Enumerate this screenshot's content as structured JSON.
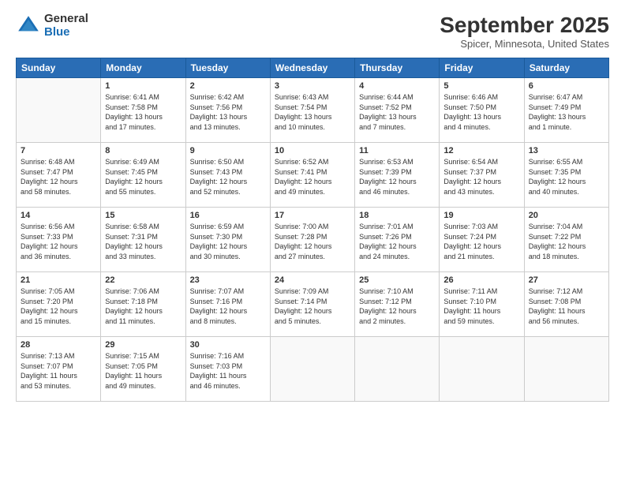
{
  "logo": {
    "general": "General",
    "blue": "Blue"
  },
  "title": {
    "main": "September 2025",
    "sub": "Spicer, Minnesota, United States"
  },
  "weekdays": [
    "Sunday",
    "Monday",
    "Tuesday",
    "Wednesday",
    "Thursday",
    "Friday",
    "Saturday"
  ],
  "weeks": [
    [
      {
        "day": "",
        "info": ""
      },
      {
        "day": "1",
        "info": "Sunrise: 6:41 AM\nSunset: 7:58 PM\nDaylight: 13 hours\nand 17 minutes."
      },
      {
        "day": "2",
        "info": "Sunrise: 6:42 AM\nSunset: 7:56 PM\nDaylight: 13 hours\nand 13 minutes."
      },
      {
        "day": "3",
        "info": "Sunrise: 6:43 AM\nSunset: 7:54 PM\nDaylight: 13 hours\nand 10 minutes."
      },
      {
        "day": "4",
        "info": "Sunrise: 6:44 AM\nSunset: 7:52 PM\nDaylight: 13 hours\nand 7 minutes."
      },
      {
        "day": "5",
        "info": "Sunrise: 6:46 AM\nSunset: 7:50 PM\nDaylight: 13 hours\nand 4 minutes."
      },
      {
        "day": "6",
        "info": "Sunrise: 6:47 AM\nSunset: 7:49 PM\nDaylight: 13 hours\nand 1 minute."
      }
    ],
    [
      {
        "day": "7",
        "info": "Sunrise: 6:48 AM\nSunset: 7:47 PM\nDaylight: 12 hours\nand 58 minutes."
      },
      {
        "day": "8",
        "info": "Sunrise: 6:49 AM\nSunset: 7:45 PM\nDaylight: 12 hours\nand 55 minutes."
      },
      {
        "day": "9",
        "info": "Sunrise: 6:50 AM\nSunset: 7:43 PM\nDaylight: 12 hours\nand 52 minutes."
      },
      {
        "day": "10",
        "info": "Sunrise: 6:52 AM\nSunset: 7:41 PM\nDaylight: 12 hours\nand 49 minutes."
      },
      {
        "day": "11",
        "info": "Sunrise: 6:53 AM\nSunset: 7:39 PM\nDaylight: 12 hours\nand 46 minutes."
      },
      {
        "day": "12",
        "info": "Sunrise: 6:54 AM\nSunset: 7:37 PM\nDaylight: 12 hours\nand 43 minutes."
      },
      {
        "day": "13",
        "info": "Sunrise: 6:55 AM\nSunset: 7:35 PM\nDaylight: 12 hours\nand 40 minutes."
      }
    ],
    [
      {
        "day": "14",
        "info": "Sunrise: 6:56 AM\nSunset: 7:33 PM\nDaylight: 12 hours\nand 36 minutes."
      },
      {
        "day": "15",
        "info": "Sunrise: 6:58 AM\nSunset: 7:31 PM\nDaylight: 12 hours\nand 33 minutes."
      },
      {
        "day": "16",
        "info": "Sunrise: 6:59 AM\nSunset: 7:30 PM\nDaylight: 12 hours\nand 30 minutes."
      },
      {
        "day": "17",
        "info": "Sunrise: 7:00 AM\nSunset: 7:28 PM\nDaylight: 12 hours\nand 27 minutes."
      },
      {
        "day": "18",
        "info": "Sunrise: 7:01 AM\nSunset: 7:26 PM\nDaylight: 12 hours\nand 24 minutes."
      },
      {
        "day": "19",
        "info": "Sunrise: 7:03 AM\nSunset: 7:24 PM\nDaylight: 12 hours\nand 21 minutes."
      },
      {
        "day": "20",
        "info": "Sunrise: 7:04 AM\nSunset: 7:22 PM\nDaylight: 12 hours\nand 18 minutes."
      }
    ],
    [
      {
        "day": "21",
        "info": "Sunrise: 7:05 AM\nSunset: 7:20 PM\nDaylight: 12 hours\nand 15 minutes."
      },
      {
        "day": "22",
        "info": "Sunrise: 7:06 AM\nSunset: 7:18 PM\nDaylight: 12 hours\nand 11 minutes."
      },
      {
        "day": "23",
        "info": "Sunrise: 7:07 AM\nSunset: 7:16 PM\nDaylight: 12 hours\nand 8 minutes."
      },
      {
        "day": "24",
        "info": "Sunrise: 7:09 AM\nSunset: 7:14 PM\nDaylight: 12 hours\nand 5 minutes."
      },
      {
        "day": "25",
        "info": "Sunrise: 7:10 AM\nSunset: 7:12 PM\nDaylight: 12 hours\nand 2 minutes."
      },
      {
        "day": "26",
        "info": "Sunrise: 7:11 AM\nSunset: 7:10 PM\nDaylight: 11 hours\nand 59 minutes."
      },
      {
        "day": "27",
        "info": "Sunrise: 7:12 AM\nSunset: 7:08 PM\nDaylight: 11 hours\nand 56 minutes."
      }
    ],
    [
      {
        "day": "28",
        "info": "Sunrise: 7:13 AM\nSunset: 7:07 PM\nDaylight: 11 hours\nand 53 minutes."
      },
      {
        "day": "29",
        "info": "Sunrise: 7:15 AM\nSunset: 7:05 PM\nDaylight: 11 hours\nand 49 minutes."
      },
      {
        "day": "30",
        "info": "Sunrise: 7:16 AM\nSunset: 7:03 PM\nDaylight: 11 hours\nand 46 minutes."
      },
      {
        "day": "",
        "info": ""
      },
      {
        "day": "",
        "info": ""
      },
      {
        "day": "",
        "info": ""
      },
      {
        "day": "",
        "info": ""
      }
    ]
  ]
}
